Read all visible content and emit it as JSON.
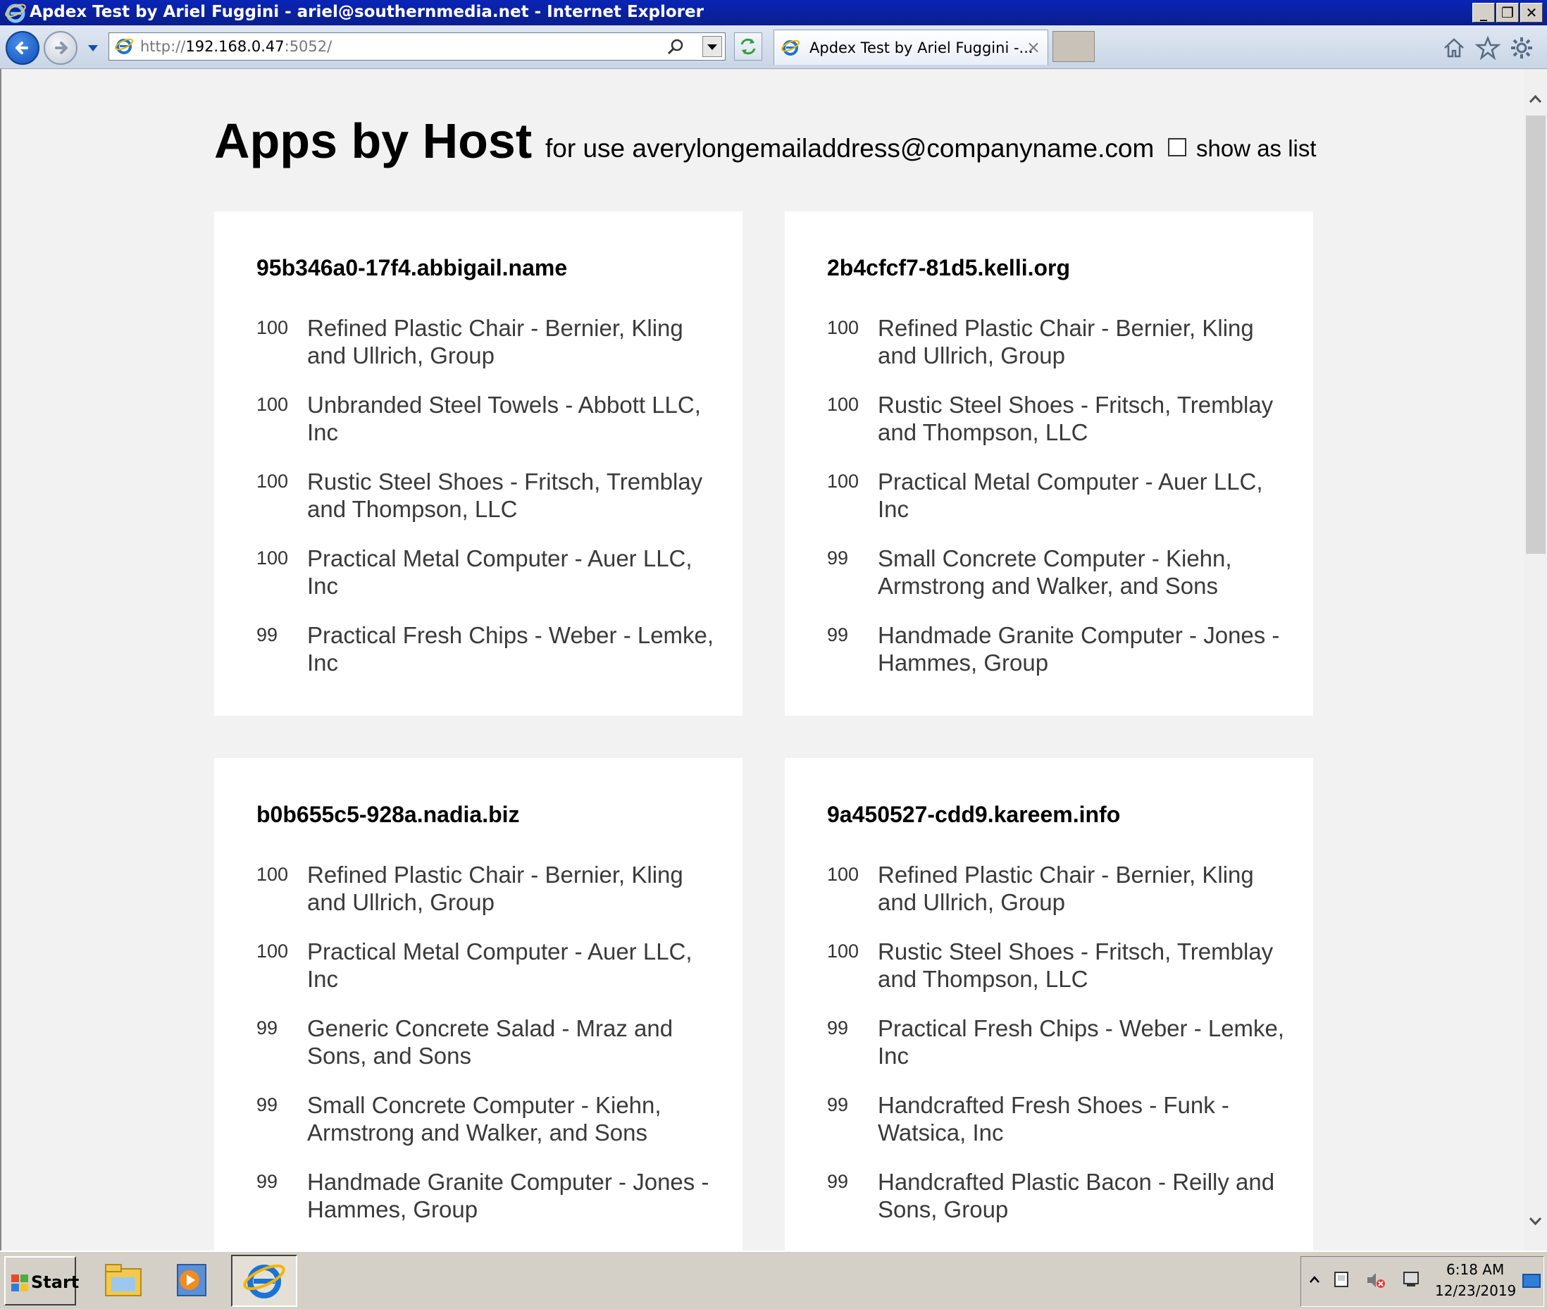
{
  "window": {
    "title": "Apdex Test by Ariel Fuggini - ariel@southernmedia.net - Internet Explorer"
  },
  "browser": {
    "url_prefix": "http://",
    "url_host": "192.168.0.47",
    "url_port": ":5052/",
    "tab_title": "Apdex Test by Ariel Fuggini -...",
    "tab_close": "×"
  },
  "page": {
    "title": "Apps by Host",
    "subtitle": "for use averylongemailaddress@companyname.com",
    "show_list_label": "show as list"
  },
  "hosts": [
    {
      "name": "95b346a0-17f4.abbigail.name",
      "apps": [
        {
          "score": "100",
          "name": "Refined Plastic Chair - Bernier, Kling and Ullrich, Group"
        },
        {
          "score": "100",
          "name": "Unbranded Steel Towels - Abbott LLC, Inc"
        },
        {
          "score": "100",
          "name": "Rustic Steel Shoes - Fritsch, Tremblay and Thompson, LLC"
        },
        {
          "score": "100",
          "name": "Practical Metal Computer - Auer LLC, Inc"
        },
        {
          "score": "99",
          "name": "Practical Fresh Chips - Weber - Lemke, Inc"
        }
      ]
    },
    {
      "name": "2b4cfcf7-81d5.kelli.org",
      "apps": [
        {
          "score": "100",
          "name": "Refined Plastic Chair - Bernier, Kling and Ullrich, Group"
        },
        {
          "score": "100",
          "name": "Rustic Steel Shoes - Fritsch, Tremblay and Thompson, LLC"
        },
        {
          "score": "100",
          "name": "Practical Metal Computer - Auer LLC, Inc"
        },
        {
          "score": "99",
          "name": "Small Concrete Computer - Kiehn, Armstrong and Walker, and Sons"
        },
        {
          "score": "99",
          "name": "Handmade Granite Computer - Jones - Hammes, Group"
        }
      ]
    },
    {
      "name": "b0b655c5-928a.nadia.biz",
      "apps": [
        {
          "score": "100",
          "name": "Refined Plastic Chair - Bernier, Kling and Ullrich, Group"
        },
        {
          "score": "100",
          "name": "Practical Metal Computer - Auer LLC, Inc"
        },
        {
          "score": "99",
          "name": "Generic Concrete Salad - Mraz and Sons, and Sons"
        },
        {
          "score": "99",
          "name": "Small Concrete Computer - Kiehn, Armstrong and Walker, and Sons"
        },
        {
          "score": "99",
          "name": "Handmade Granite Computer - Jones - Hammes, Group"
        }
      ]
    },
    {
      "name": "9a450527-cdd9.kareem.info",
      "apps": [
        {
          "score": "100",
          "name": "Refined Plastic Chair - Bernier, Kling and Ullrich, Group"
        },
        {
          "score": "100",
          "name": "Rustic Steel Shoes - Fritsch, Tremblay and Thompson, LLC"
        },
        {
          "score": "99",
          "name": "Practical Fresh Chips - Weber - Lemke, Inc"
        },
        {
          "score": "99",
          "name": "Handcrafted Fresh Shoes - Funk - Watsica, Inc"
        },
        {
          "score": "99",
          "name": "Handcrafted Plastic Bacon - Reilly and Sons, Group"
        }
      ]
    }
  ],
  "taskbar": {
    "start_label": "Start",
    "time": "6:18 AM",
    "date": "12/23/2019"
  },
  "colors": {
    "titlebar": "#0a24b6",
    "card_bg": "#ffffff",
    "page_bg": "#f2f2f2"
  }
}
